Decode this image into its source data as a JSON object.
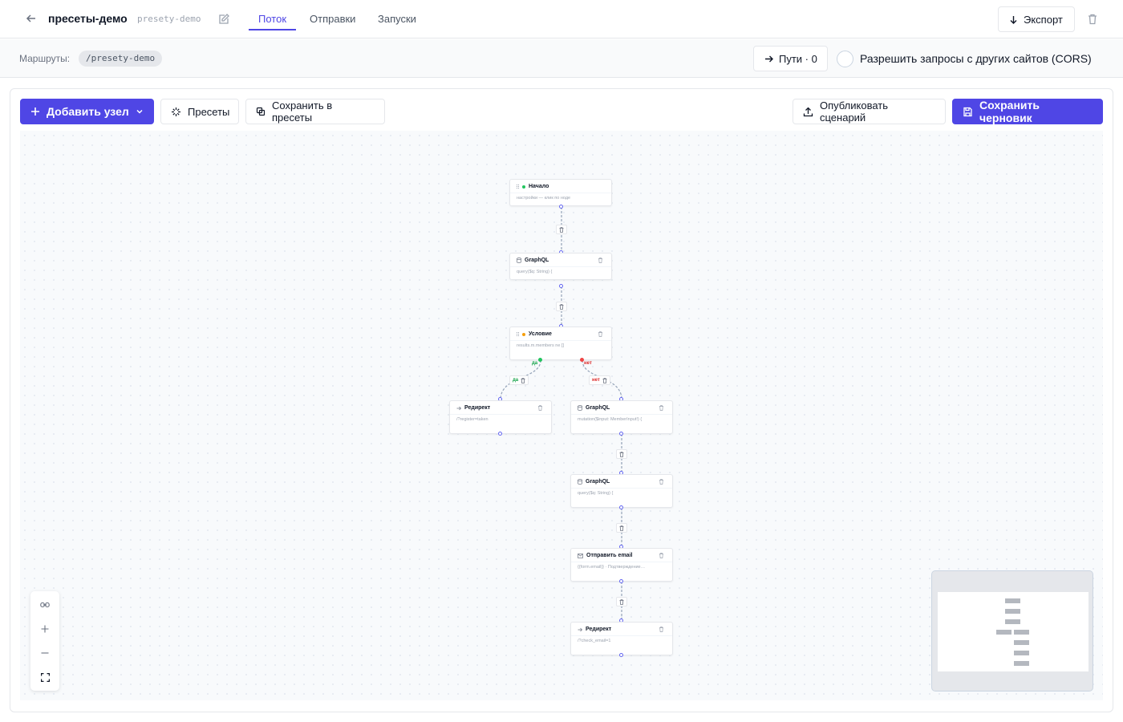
{
  "header": {
    "title": "пресеты-демо",
    "slug": "presety-demo",
    "tabs": [
      {
        "label": "Поток",
        "active": true
      },
      {
        "label": "Отправки",
        "active": false
      },
      {
        "label": "Запуски",
        "active": false
      }
    ],
    "export_label": "Экспорт"
  },
  "routes": {
    "label": "Маршруты:",
    "path": "/presety-demo",
    "paths_button": "Пути · 0",
    "cors_label": "Разрешить запросы с других сайтов (CORS)",
    "cors_enabled": false
  },
  "toolbar": {
    "add_node": "Добавить узел",
    "presets": "Пресеты",
    "save_presets": "Сохранить в пресеты",
    "publish": "Опубликовать сценарий",
    "save_draft": "Сохранить черновик"
  },
  "colors": {
    "accent": "#4f46e5",
    "yes": "#22c55e",
    "no": "#ef4444"
  },
  "flow": {
    "nodes": [
      {
        "title": "Начало",
        "body": "настройки — клик по ноде",
        "icon": "grip-icon"
      },
      {
        "title": "GraphQL",
        "body": "query($q: String) {",
        "icon": "database-icon"
      },
      {
        "title": "Условие",
        "body": "results.m.members ne []",
        "icon": "grip-icon"
      },
      {
        "title": "Редирект",
        "body": "/?register=taken",
        "icon": "arrow-right-icon"
      },
      {
        "title": "GraphQL",
        "body": "mutation($input: MemberInput!) {",
        "icon": "database-icon"
      },
      {
        "title": "GraphQL",
        "body": "query($q: String) {",
        "icon": "database-icon"
      },
      {
        "title": "Отправить email",
        "body": "{{form.email}} · Подтверждение…",
        "icon": "mail-icon"
      },
      {
        "title": "Редирект",
        "body": "/?check_email=1",
        "icon": "arrow-right-icon"
      }
    ],
    "branch_yes": "да",
    "branch_no": "нет"
  }
}
